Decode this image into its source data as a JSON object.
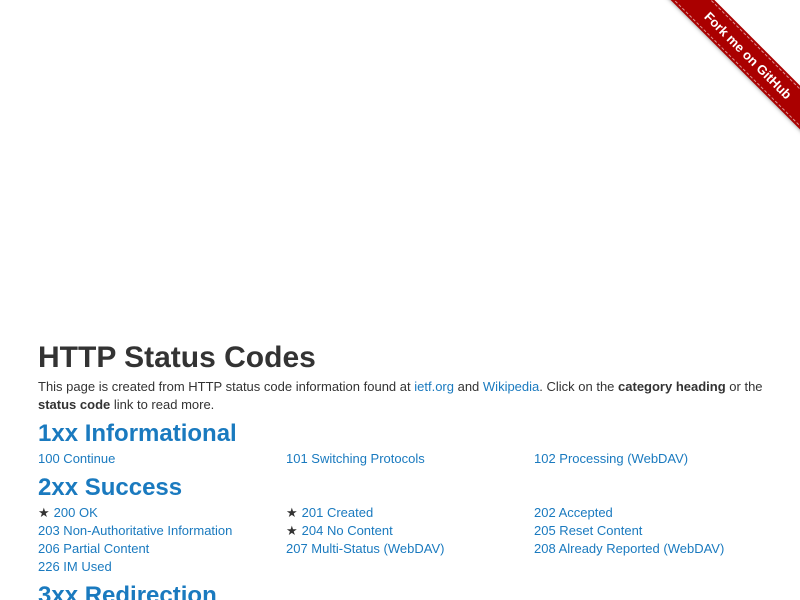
{
  "ribbon": {
    "label": "Fork me on GitHub"
  },
  "page": {
    "title": "HTTP Status Codes",
    "intro": {
      "prefix": "This page is created from HTTP status code information found at ",
      "link1": "ietf.org",
      "and": " and ",
      "link2": "Wikipedia",
      "middle": ". Click on the ",
      "bold1": "category heading",
      "or": " or the ",
      "bold2": "status code",
      "suffix": " link to read more."
    }
  },
  "categories": [
    {
      "heading": "1xx Informational",
      "codes": [
        {
          "label": "100 Continue",
          "starred": false
        },
        {
          "label": "101 Switching Protocols",
          "starred": false
        },
        {
          "label": "102 Processing (WebDAV)",
          "starred": false
        }
      ]
    },
    {
      "heading": "2xx Success",
      "codes": [
        {
          "label": "200 OK",
          "starred": true
        },
        {
          "label": "201 Created",
          "starred": true
        },
        {
          "label": "202 Accepted",
          "starred": false
        },
        {
          "label": "203 Non-Authoritative Information",
          "starred": false
        },
        {
          "label": "204 No Content",
          "starred": true
        },
        {
          "label": "205 Reset Content",
          "starred": false
        },
        {
          "label": "206 Partial Content",
          "starred": false
        },
        {
          "label": "207 Multi-Status (WebDAV)",
          "starred": false
        },
        {
          "label": "208 Already Reported (WebDAV)",
          "starred": false
        },
        {
          "label": "226 IM Used",
          "starred": false
        }
      ]
    },
    {
      "heading": "3xx Redirection",
      "codes": []
    }
  ],
  "star_glyph": "★",
  "colors": {
    "link": "#1a7abf",
    "ribbon": "#aa0000",
    "text": "#333333"
  }
}
